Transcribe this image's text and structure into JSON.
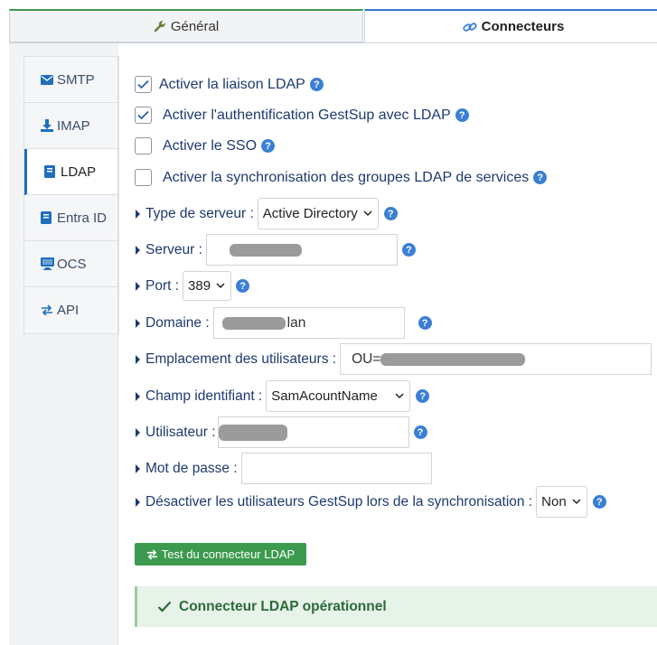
{
  "top_tabs": [
    {
      "label": "Général",
      "icon": "wrench-icon",
      "active": false
    },
    {
      "label": "Connecteurs",
      "icon": "link-icon",
      "active": true
    }
  ],
  "side_menu": [
    {
      "label": "SMTP",
      "icon": "envelope-icon"
    },
    {
      "label": "IMAP",
      "icon": "download-icon"
    },
    {
      "label": "LDAP",
      "icon": "book-icon",
      "active": true
    },
    {
      "label": "Entra ID",
      "icon": "book-icon"
    },
    {
      "label": "OCS",
      "icon": "monitor-icon"
    },
    {
      "label": "API",
      "icon": "exchange-icon"
    }
  ],
  "checkboxes": [
    {
      "label": "Activer la liaison LDAP",
      "checked": true
    },
    {
      "label": "Activer l'authentification GestSup avec LDAP",
      "checked": true
    },
    {
      "label": "Activer le SSO",
      "checked": false
    },
    {
      "label": "Activer la synchronisation des groupes LDAP de services",
      "checked": false
    }
  ],
  "fields": {
    "server_type": {
      "label": "Type de serveur :",
      "value": "Active Directory"
    },
    "server": {
      "label": "Serveur :",
      "value": ""
    },
    "port": {
      "label": "Port :",
      "value": "389"
    },
    "domain": {
      "label": "Domaine :",
      "value": "lan"
    },
    "users_location": {
      "label": "Emplacement des utilisateurs :",
      "value": "OU="
    },
    "id_field": {
      "label": "Champ identifiant :",
      "value": "SamAcountName"
    },
    "user": {
      "label": "Utilisateur :",
      "value": ""
    },
    "password": {
      "label": "Mot de passe :",
      "value": ""
    },
    "disable_users": {
      "label": "Désactiver les utilisateurs GestSup lors de la synchronisation :",
      "value": "Non"
    }
  },
  "test_button": {
    "label": "Test du connecteur LDAP",
    "icon": "exchange-icon"
  },
  "status": {
    "label": "Connecteur LDAP opérationnel",
    "icon": "check-icon"
  },
  "colors": {
    "accent": "#3a7fd5",
    "success": "#3c9a4e",
    "text": "#1d3a6e"
  }
}
